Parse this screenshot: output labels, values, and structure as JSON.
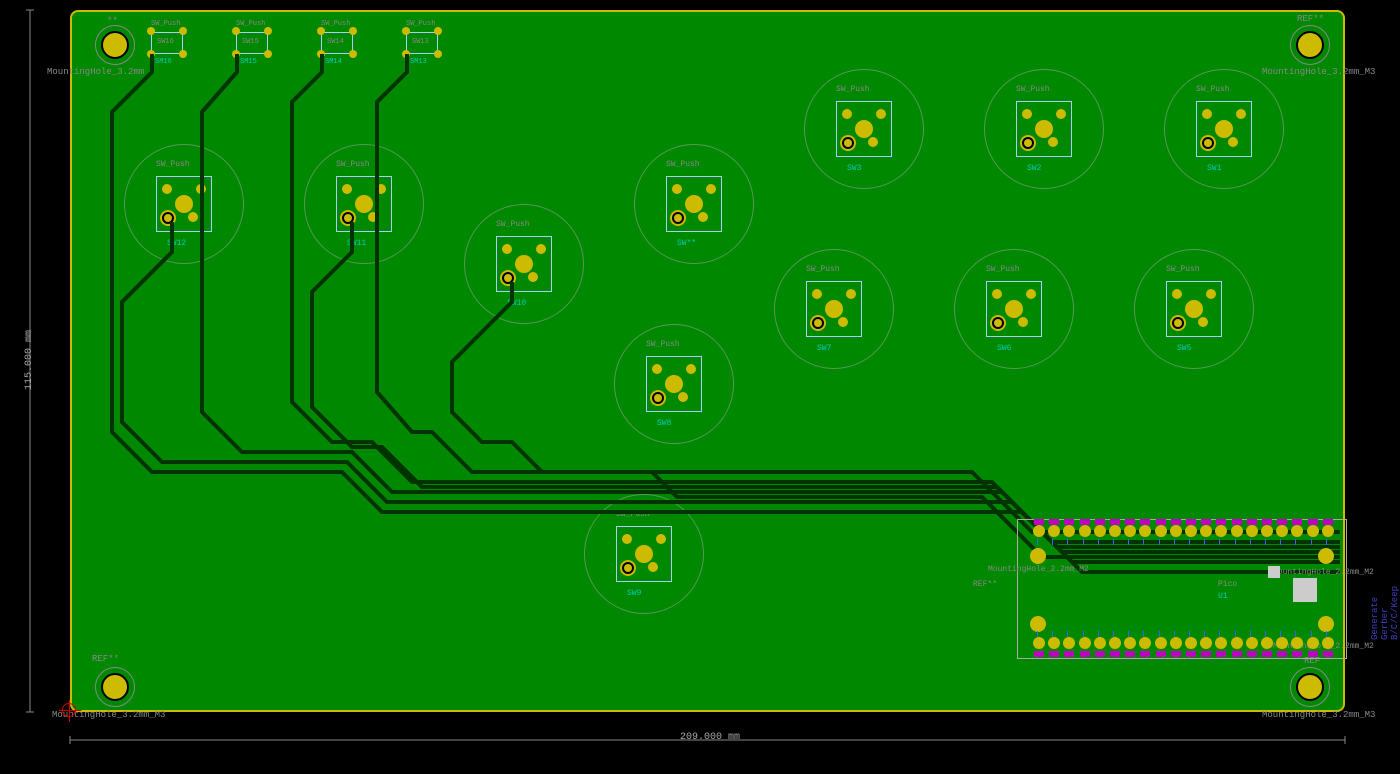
{
  "dimensions": {
    "width_label": "209.000 mm",
    "height_label": "115.000 mm"
  },
  "mounting_holes": {
    "label_tl": "MountingHole_3.2mm",
    "label_tr": "MountingHole_3.2mm_M3",
    "label_bl": "MountingHole_3.2mm_M3",
    "label_br": "MountingHole_3.2mm_M3"
  },
  "refs": {
    "ref": "REF**",
    "pico_ref": "REF**"
  },
  "pico": {
    "name": "Pico",
    "u1": "U1",
    "mh_label_l": "MountingHole_2.2mm_M2",
    "mh_label_r": "MountingHole_2.2mm_M2",
    "mh_label_br": "MountingHole_2.2mm_M2"
  },
  "small_switches": [
    {
      "ref": "SW16",
      "id": "SM16"
    },
    {
      "ref": "SW15",
      "id": "SM15"
    },
    {
      "ref": "SW14",
      "id": "SM14"
    },
    {
      "ref": "SW13",
      "id": "SM13"
    }
  ],
  "sw_push_label": "SW_Push",
  "arc_buttons": {
    "sw12": "SW12",
    "sw11": "SW11",
    "sw10": "SW10",
    "sw9": "SW9",
    "sw8": "SW8",
    "sw7": "SW7",
    "sw6": "SW6",
    "sw5": "SW5",
    "sw3": "SW3",
    "sw2": "SW2",
    "sw1": "SW1",
    "sw0_a": "SW**",
    "sw0_b": "SW**"
  },
  "side_text": "Generate Gerber B/C/C/Keep Zone"
}
